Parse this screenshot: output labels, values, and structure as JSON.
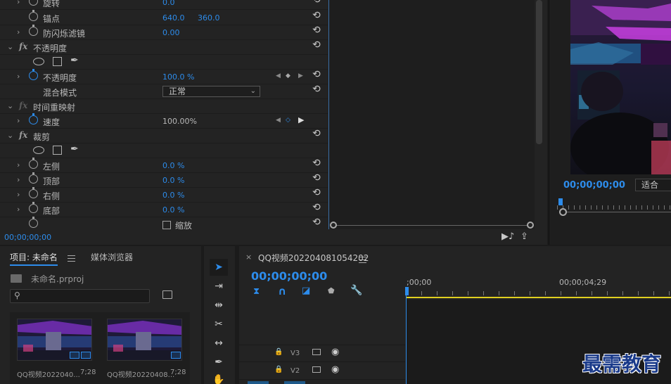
{
  "effect_controls": {
    "rows": [
      {
        "name": "旋转",
        "v1": "0.0",
        "v2": ""
      },
      {
        "name": "锚点",
        "v1": "640.0",
        "v2": "360.0"
      },
      {
        "name": "防闪烁滤镜",
        "v1": "0.00",
        "v2": ""
      },
      {
        "name": "不透明度"
      },
      {
        "name": "不透明度",
        "v1": "100.0 %"
      },
      {
        "name": "混合模式",
        "dropdown": "正常"
      },
      {
        "name": "时间重映射"
      },
      {
        "name": "速度",
        "v1": "100.00%"
      },
      {
        "name": "裁剪"
      },
      {
        "name": "左侧",
        "v1": "0.0 %"
      },
      {
        "name": "顶部",
        "v1": "0.0 %"
      },
      {
        "name": "右侧",
        "v1": "0.0 %"
      },
      {
        "name": "底部",
        "v1": "0.0 %"
      },
      {
        "name": "缩放",
        "checkbox": true
      }
    ],
    "timecode": "00;00;00;00"
  },
  "monitor": {
    "timecode": "00;00;00;00",
    "fit": "适合"
  },
  "project": {
    "tab_project": "项目: 未命名",
    "tab_media": "媒体浏览器",
    "file": "未命名.prproj",
    "search_placeholder": "",
    "items": [
      {
        "name": "QQ视频2022040...",
        "duration": "7;28"
      },
      {
        "name": "QQ视频20220408...",
        "duration": "7;28"
      }
    ]
  },
  "timeline": {
    "sequence_name": "QQ视频202204081054202",
    "timecode": "00;00;00;00",
    "ruler": [
      ";00;00",
      "00;00;04;29"
    ],
    "tracks": [
      "V3",
      "V2"
    ]
  },
  "watermark": "最需教育",
  "colors": {
    "accent": "#2d8ceb",
    "work_area": "#e0d020",
    "panel": "#232323"
  }
}
